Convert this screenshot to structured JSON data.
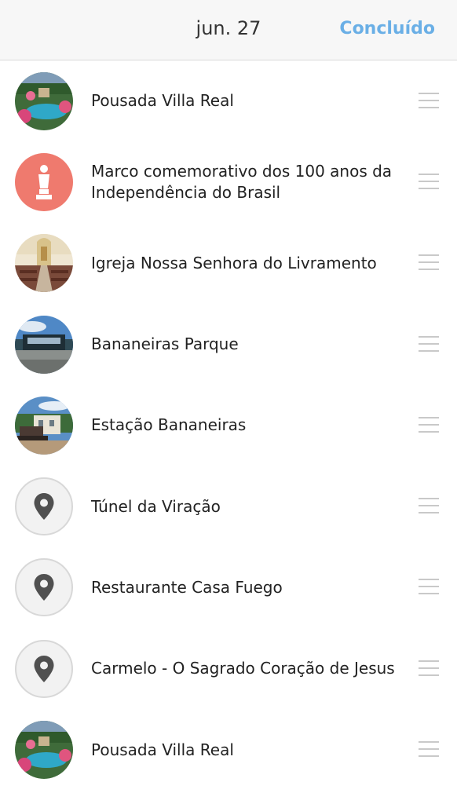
{
  "header": {
    "title": "jun. 27",
    "done_label": "Concluído"
  },
  "colors": {
    "accent": "#6aafe6",
    "monument_badge": "#ef7a6e"
  },
  "places": [
    {
      "name": "Pousada Villa Real",
      "icon": "photo-garden-pool"
    },
    {
      "name": "Marco comemorativo dos 100 anos da Independência do Brasil",
      "icon": "monument-icon"
    },
    {
      "name": "Igreja Nossa Senhora do Livramento",
      "icon": "photo-church-interior"
    },
    {
      "name": "Bananeiras Parque",
      "icon": "photo-park"
    },
    {
      "name": "Estação Bananeiras",
      "icon": "photo-train-station"
    },
    {
      "name": "Túnel da Viração",
      "icon": "map-pin-icon"
    },
    {
      "name": "Restaurante Casa Fuego",
      "icon": "map-pin-icon"
    },
    {
      "name": "Carmelo - O Sagrado Coração de Jesus",
      "icon": "map-pin-icon"
    },
    {
      "name": "Pousada Villa Real",
      "icon": "photo-garden-pool"
    }
  ]
}
